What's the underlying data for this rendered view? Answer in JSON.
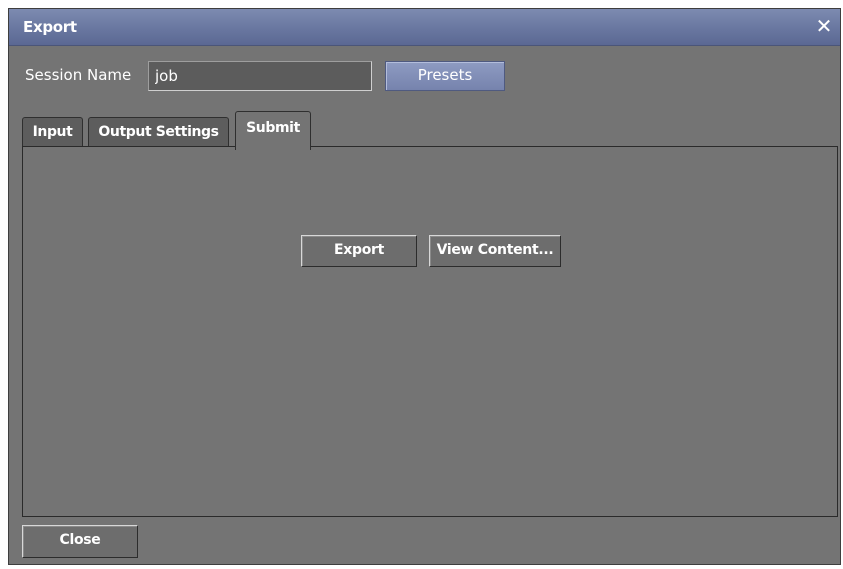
{
  "window": {
    "title": "Export",
    "close_glyph": "✕"
  },
  "session": {
    "label": "Session Name",
    "value": "job",
    "presets_label": "Presets"
  },
  "tabs": [
    {
      "label": "Input",
      "active": false
    },
    {
      "label": "Output Settings",
      "active": false
    },
    {
      "label": "Submit",
      "active": true
    }
  ],
  "submit_panel": {
    "export_label": "Export",
    "view_content_label": "View Content..."
  },
  "footer": {
    "close_label": "Close"
  },
  "colors": {
    "titlebar": "#6977a0",
    "background": "#747474",
    "accent_button": "#7683ad"
  }
}
